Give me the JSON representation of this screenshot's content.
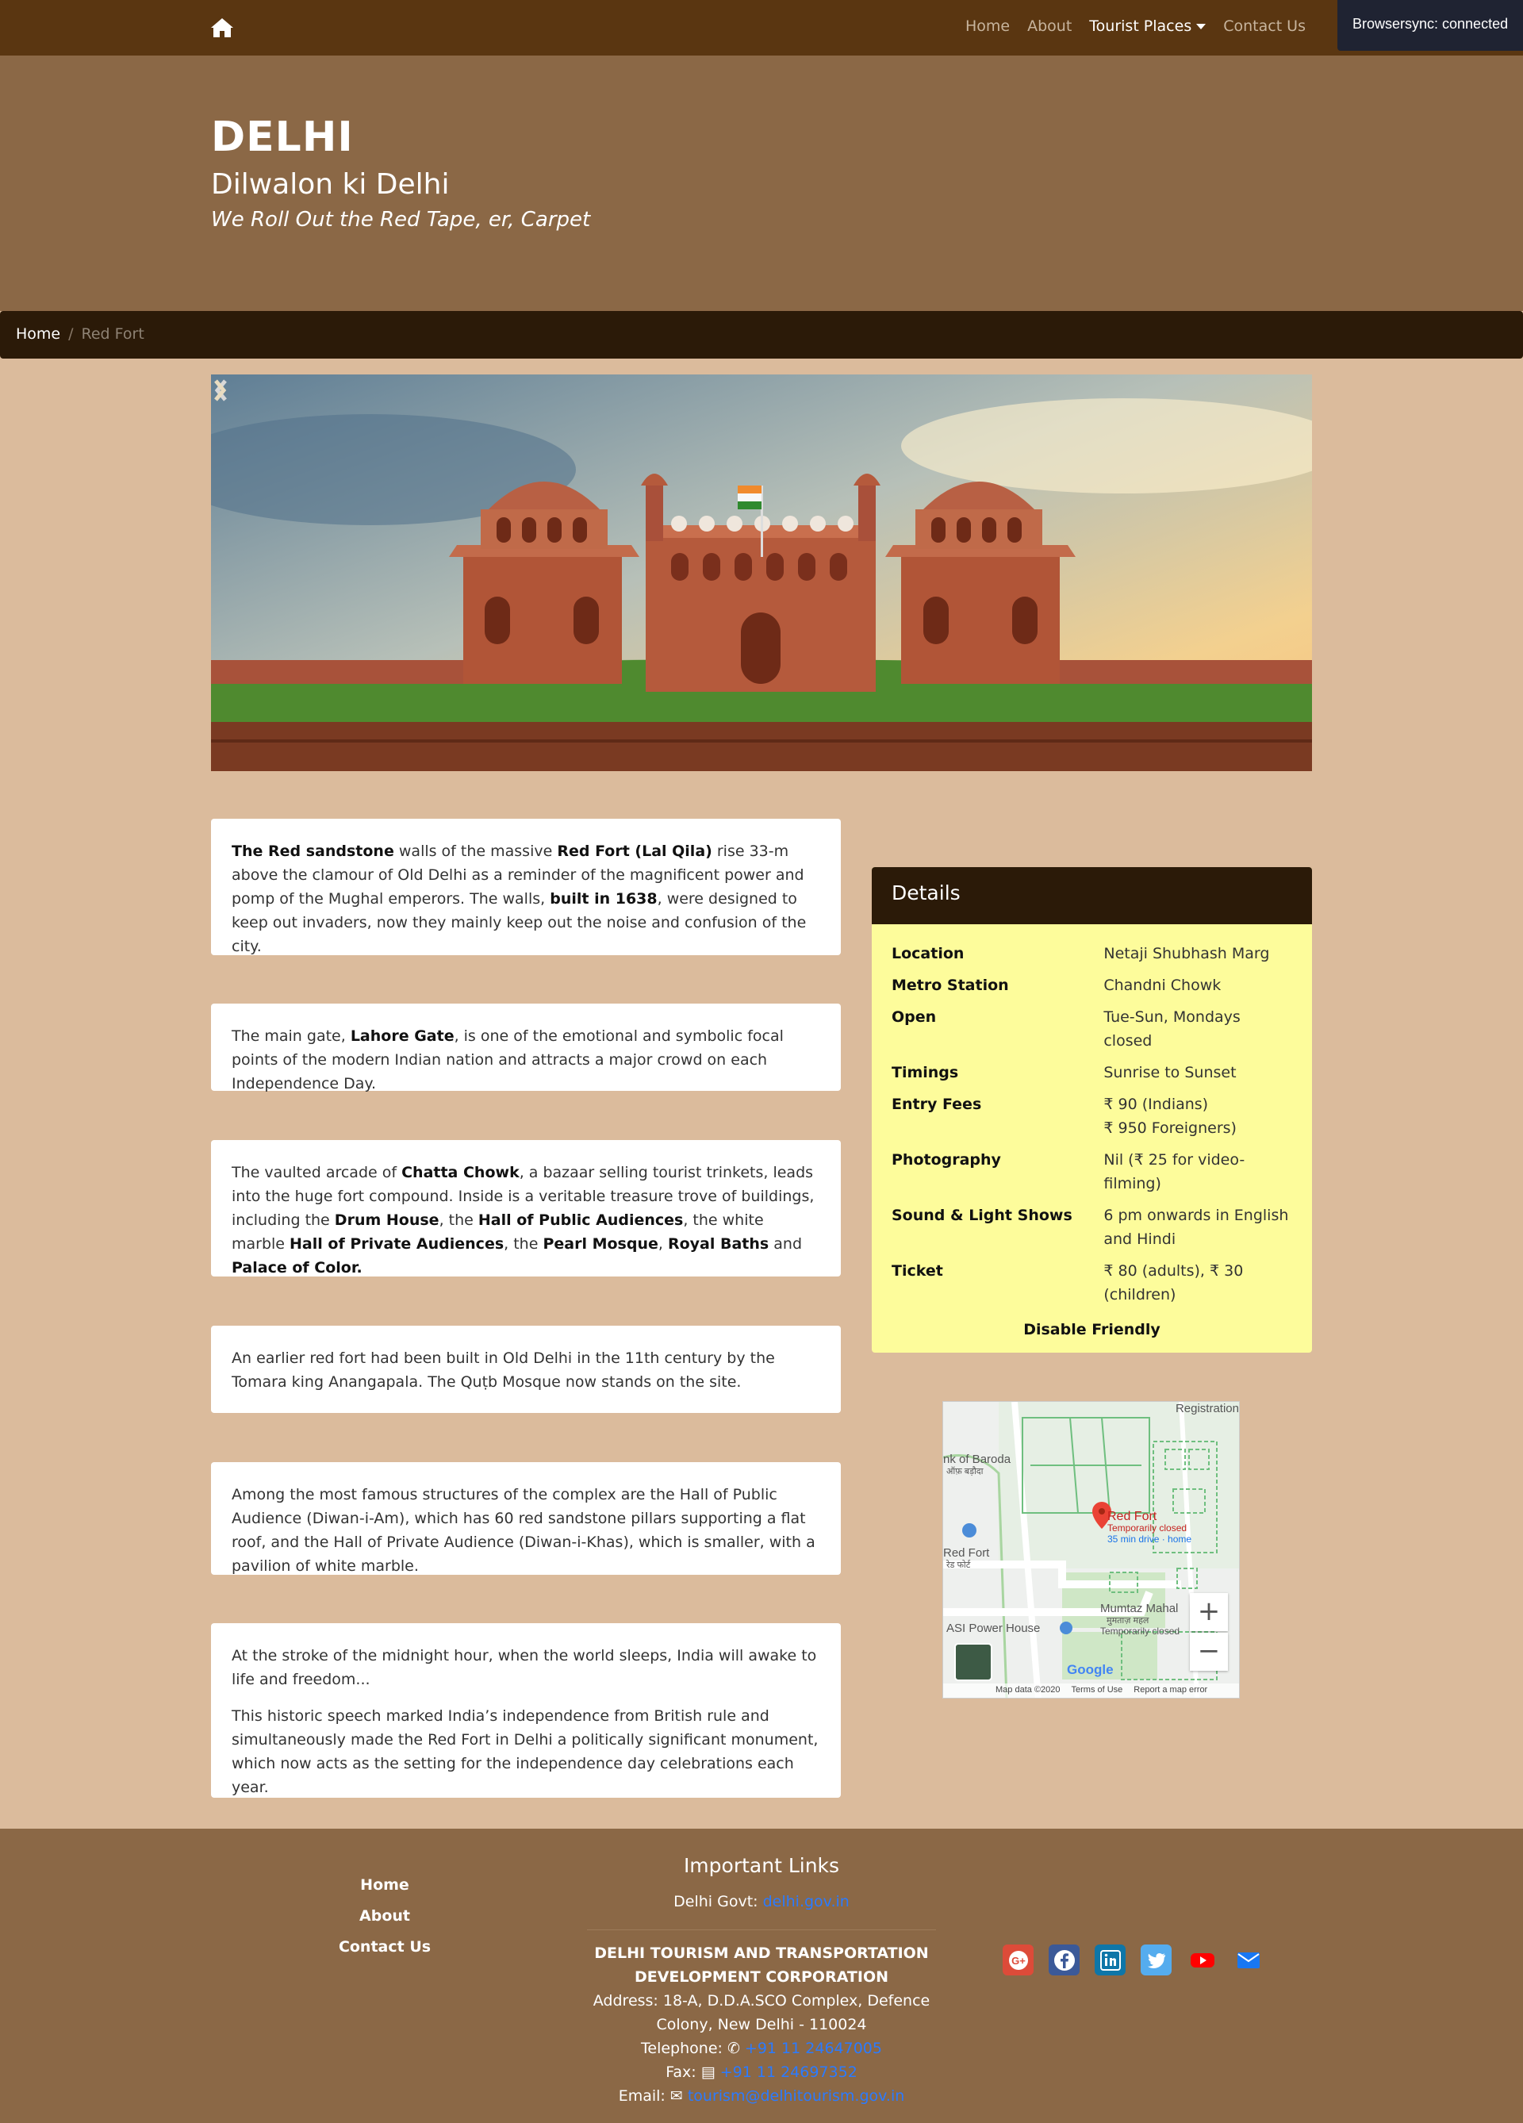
{
  "navbar": {
    "home_icon": "home-icon",
    "links": [
      "Home",
      "About",
      "Tourist Places",
      "Contact Us"
    ],
    "active": "Tourist Places"
  },
  "browsersync": "Browsersync: connected",
  "hero": {
    "title": "DELHI",
    "subtitle": "Dilwalon ki Delhi",
    "tagline": "We Roll Out the Red Tape, er, Carpet"
  },
  "breadcrumb": {
    "home": "Home",
    "separator": "/",
    "current": "Red Fort"
  },
  "carousel": {
    "image_alt": "Red Fort",
    "prev_icon": "chevron-left-icon",
    "next_icon": "chevron-right-icon"
  },
  "cards": [
    {
      "parts": [
        {
          "b": "The Red sandstone"
        },
        {
          "t": " walls of the massive "
        },
        {
          "b": "Red Fort (Lal Qila)"
        },
        {
          "t": " rise 33-m above the clamour of Old Delhi as a reminder of the magnificent power and pomp of the Mughal emperors. The walls, "
        },
        {
          "b": "built in 1638"
        },
        {
          "t": ", were designed to keep out invaders, now they mainly keep out the noise and confusion of the city."
        }
      ]
    },
    {
      "parts": [
        {
          "t": "The main gate, "
        },
        {
          "b": "Lahore Gate"
        },
        {
          "t": ", is one of the emotional and symbolic focal points of the modern Indian nation and attracts a major crowd on each Independence Day."
        }
      ]
    },
    {
      "parts": [
        {
          "t": "The vaulted arcade of "
        },
        {
          "b": "Chatta Chowk"
        },
        {
          "t": ", a bazaar selling tourist trinkets, leads into the huge fort compound. Inside is a veritable treasure trove of buildings, including the "
        },
        {
          "b": "Drum House"
        },
        {
          "t": ", the "
        },
        {
          "b": "Hall of Public Audiences"
        },
        {
          "t": ", the white marble "
        },
        {
          "b": "Hall of Private Audiences"
        },
        {
          "t": ", the "
        },
        {
          "b": "Pearl Mosque"
        },
        {
          "t": ", "
        },
        {
          "b": "Royal Baths"
        },
        {
          "t": " and "
        },
        {
          "b": "Palace of Color."
        }
      ]
    },
    {
      "parts": [
        {
          "t": "An earlier red fort had been built in Old Delhi in the 11th century by the Tomara king Anangapala. The Quṭb Mosque now stands on the site."
        }
      ]
    },
    {
      "parts": [
        {
          "t": "Among the most famous structures of the complex are the Hall of Public Audience (Diwan-i-Am), which has 60 red sandstone pillars supporting a flat roof, and the Hall of Private Audience (Diwan-i-Khas), which is smaller, with a pavilion of white marble."
        }
      ]
    },
    {
      "paragraphs": [
        "At the stroke of the midnight hour, when the world sleeps, India will awake to life and freedom...",
        "This historic speech marked India’s independence from British rule and simultaneously made the Red Fort in Delhi a politically significant monument, which now acts as the setting for the independence day celebrations each year."
      ]
    }
  ],
  "details": {
    "title": "Details",
    "rows": [
      {
        "label": "Location",
        "value": "Netaji Shubhash Marg"
      },
      {
        "label": "Metro Station",
        "value": "Chandni Chowk"
      },
      {
        "label": "Open",
        "value": "Tue-Sun, Mondays closed"
      },
      {
        "label": "Timings",
        "value": "Sunrise to Sunset"
      },
      {
        "label": "Entry Fees",
        "value": "₹ 90 (Indians)\n₹ 950 Foreigners)"
      },
      {
        "label": "Photography",
        "value": "Nil (₹ 25 for video-filming)"
      },
      {
        "label": "Sound & Light Shows",
        "value": "6 pm onwards in English and Hindi"
      },
      {
        "label": "Ticket",
        "value": "₹ 80 (adults), ₹ 30 (children)"
      }
    ],
    "footer": "Disable Friendly"
  },
  "map": {
    "labels": {
      "registration": "Registration",
      "bank": "nk of Baroda",
      "bank_hi": "ऑफ़ बड़ौदा",
      "place": "Red Fort",
      "status": "Temporarily closed",
      "drive": "35 min drive · home",
      "redfort_left": "Red Fort",
      "redfort_hi": "रेड फोर्ट",
      "mumtaz": "Mumtaz Mahal",
      "mumtaz_hi": "मुमताज़ महल",
      "mumtaz_status": "Temporarily closed",
      "asi": "ASI Power House",
      "google": "Google"
    },
    "zoom_in": "+",
    "zoom_out": "−",
    "footer": [
      "Map data ©2020",
      "Terms of Use",
      "Report a map error"
    ]
  },
  "footer": {
    "links": [
      "Home",
      "About",
      "Contact Us"
    ],
    "important_title": "Important Links",
    "govt_label": "Delhi Govt: ",
    "govt_link": "delhi.gov.in",
    "org": "DELHI TOURISM AND TRANSPORTATION DEVELOPMENT CORPORATION",
    "address": "Address: 18-A, D.D.A.SCO Complex, Defence Colony, New Delhi - 110024",
    "telephone_label": "Telephone: ",
    "telephone": "+91 11 24647005",
    "fax_label": "Fax: ",
    "fax": "+91 11 24697352",
    "email_label": "Email: ",
    "email": "tourism@delhitourism.gov.in",
    "social": [
      "google-plus-icon",
      "facebook-icon",
      "linkedin-icon",
      "twitter-icon",
      "youtube-icon",
      "email-icon"
    ]
  },
  "colors": {
    "navbar": "#5a3611",
    "hero": "#8b6846",
    "breadcrumb": "#2b1a08",
    "page": "#dbbb9c",
    "details_body": "#fdfc9b",
    "link": "#2b7bff"
  }
}
